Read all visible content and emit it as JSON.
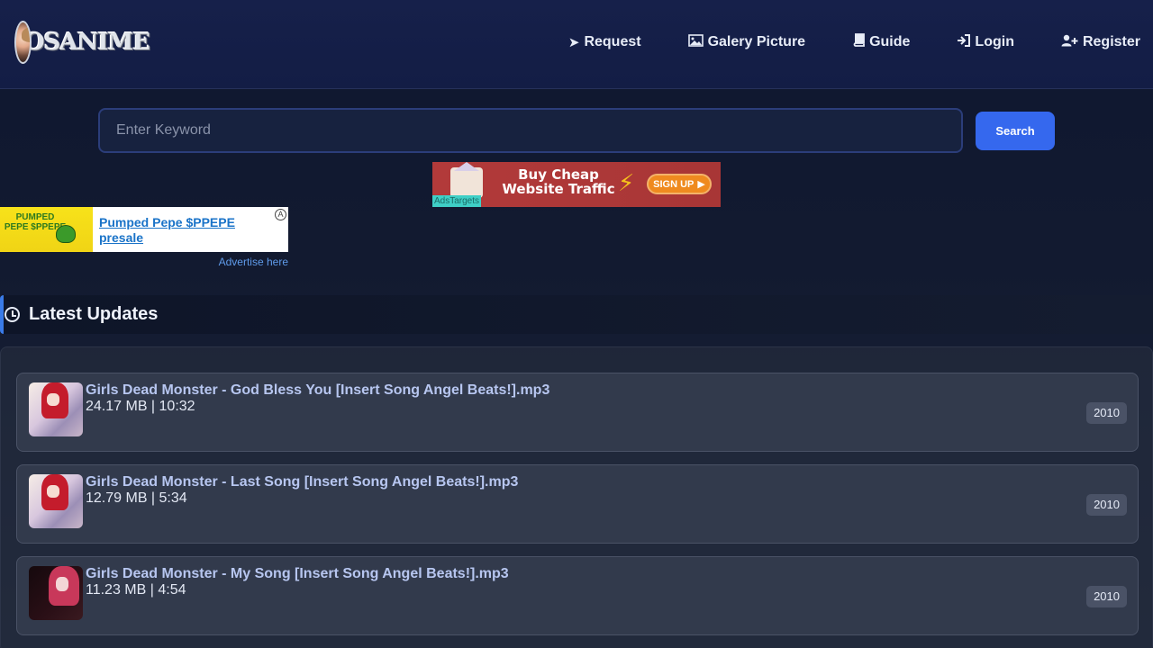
{
  "logo": {
    "text": "OSANIME"
  },
  "nav": {
    "items": [
      {
        "label": "Request",
        "icon": "paper-plane-icon",
        "glyph": "➤"
      },
      {
        "label": "Galery Picture",
        "icon": "image-icon",
        "glyph": "🖼"
      },
      {
        "label": "Guide",
        "icon": "book-icon",
        "glyph": "📖"
      },
      {
        "label": "Login",
        "icon": "sign-in-icon",
        "glyph": "⇥"
      },
      {
        "label": "Register",
        "icon": "user-plus-icon",
        "glyph": "👤"
      }
    ]
  },
  "search": {
    "placeholder": "Enter Keyword",
    "button_label": "Search"
  },
  "ads": {
    "banner_text": "Buy Cheap Website Traffic",
    "banner_cta": "SIGN UP",
    "banner_tag": "AdsTargets",
    "side_image_text": "PUMPED PEPE $PPEPE",
    "side_link": "Pumped Pepe $PPEPE presale",
    "advertise_label": "Advertise here"
  },
  "section": {
    "title": "Latest Updates"
  },
  "updates": [
    {
      "title": "Girls Dead Monster - God Bless You [Insert Song Angel Beats!].mp3",
      "meta": "24.17 MB | 10:32",
      "year": "2010"
    },
    {
      "title": "Girls Dead Monster - Last Song [Insert Song Angel Beats!].mp3",
      "meta": "12.79 MB | 5:34",
      "year": "2010"
    },
    {
      "title": "Girls Dead Monster - My Song [Insert Song Angel Beats!].mp3",
      "meta": "11.23 MB | 4:54",
      "year": "2010"
    }
  ],
  "colors": {
    "header_bg": "#131d45",
    "accent": "#3568ee",
    "title_link": "#b7c6f0"
  }
}
